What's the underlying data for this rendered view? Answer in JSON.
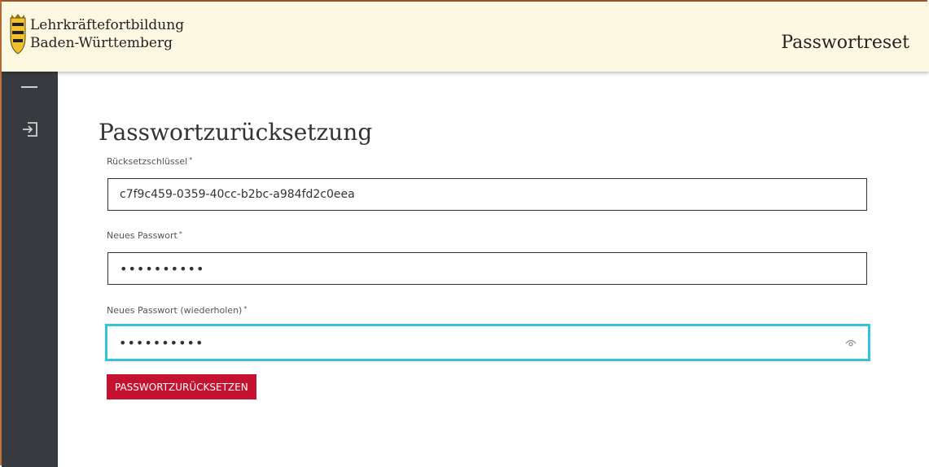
{
  "header": {
    "brand_line1": "Lehrkräftefortbildung",
    "brand_line2": "Baden-Württemberg",
    "page_name": "Passwortreset",
    "logo_icon": "baden-wuerttemberg-coat-of-arms-icon"
  },
  "sidebar": {
    "items": [
      {
        "icon": "minimize-icon"
      },
      {
        "icon": "login-icon"
      }
    ]
  },
  "form": {
    "title": "Passwortzurücksetzung",
    "fields": [
      {
        "label": "Rücksetzschlüssel",
        "required_mark": "*",
        "value": "c7f9c459-0359-40cc-b2bc-a984fd2c0eea"
      },
      {
        "label": "Neues Passwort",
        "required_mark": "*",
        "value": "••••••••••"
      },
      {
        "label": "Neues Passwort (wiederholen)",
        "required_mark": "*",
        "value": "••••••••••"
      }
    ],
    "submit_label": "PASSWORTZURÜCKSETZEN"
  },
  "colors": {
    "header_bg": "#fdf8e1",
    "sidebar_bg": "#373b40",
    "button_bg": "#c41230",
    "focus_border": "#33c3e0"
  }
}
